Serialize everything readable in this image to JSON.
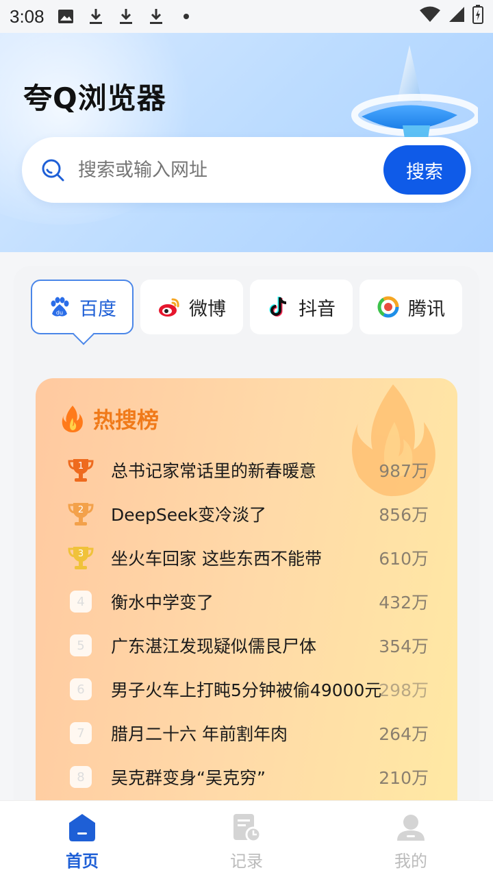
{
  "status_bar": {
    "time": "3:08"
  },
  "header": {
    "title": "夸Q浏览器",
    "search_placeholder": "搜索或输入网址",
    "search_button": "搜索"
  },
  "tabs": [
    {
      "label": "百度",
      "icon": "baidu-icon",
      "active": true
    },
    {
      "label": "微博",
      "icon": "weibo-icon",
      "active": false
    },
    {
      "label": "抖音",
      "icon": "douyin-icon",
      "active": false
    },
    {
      "label": "腾讯",
      "icon": "tencent-news-icon",
      "active": false
    }
  ],
  "hot_list": {
    "title": "热搜榜",
    "items": [
      {
        "rank": "1",
        "title": "总书记家常话里的新春暖意",
        "count": "987万"
      },
      {
        "rank": "2",
        "title": "DeepSeek变冷淡了",
        "count": "856万"
      },
      {
        "rank": "3",
        "title": "坐火车回家 这些东西不能带",
        "count": "610万"
      },
      {
        "rank": "4",
        "title": "衡水中学变了",
        "count": "432万"
      },
      {
        "rank": "5",
        "title": "广东湛江发现疑似儒艮尸体",
        "count": "354万"
      },
      {
        "rank": "6",
        "title": "男子火车上打盹5分钟被偷49000元",
        "count": "298万"
      },
      {
        "rank": "7",
        "title": "腊月二十六 年前割年肉",
        "count": "264万"
      },
      {
        "rank": "8",
        "title": "吴克群变身“吴克穷”",
        "count": "210万"
      }
    ]
  },
  "bottom_nav": [
    {
      "label": "首页",
      "icon": "home-icon",
      "active": true
    },
    {
      "label": "记录",
      "icon": "history-icon",
      "active": false
    },
    {
      "label": "我的",
      "icon": "profile-icon",
      "active": false
    }
  ],
  "colors": {
    "accent": "#0f5be8",
    "hot_title": "#f07a1a",
    "gold": "#f0c23a",
    "silver": "#f3a14a",
    "bronze": "#ee6a1e"
  }
}
